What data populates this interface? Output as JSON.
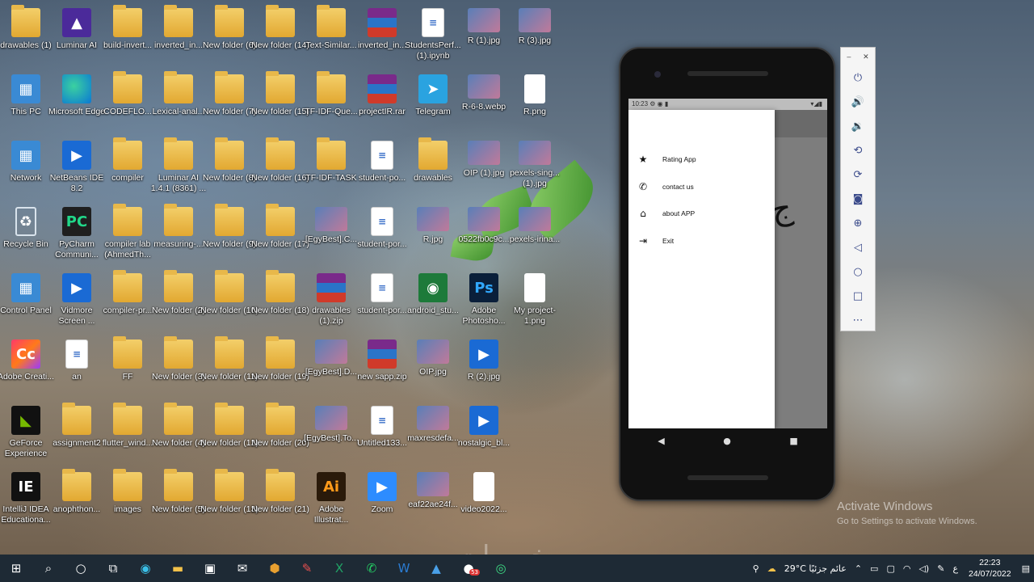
{
  "desktop": {
    "icons": [
      {
        "label": "drawables (1)",
        "icon": "folder-icon",
        "type": "folder"
      },
      {
        "label": "Luminar AI",
        "icon": "luminar-icon",
        "type": "purple"
      },
      {
        "label": "build-invert...",
        "icon": "folder-icon",
        "type": "folder"
      },
      {
        "label": "inverted_in...",
        "icon": "folder-icon",
        "type": "folder"
      },
      {
        "label": "New folder (6)",
        "icon": "folder-icon",
        "type": "folder"
      },
      {
        "label": "New folder (14)",
        "icon": "folder-icon",
        "type": "folder"
      },
      {
        "label": "Text-Similar...",
        "icon": "folder-icon",
        "type": "folder"
      },
      {
        "label": "inverted_in...",
        "icon": "winrar-icon",
        "type": "rar"
      },
      {
        "label": "StudentsPerf... (1).ipynb",
        "icon": "notebook-icon",
        "type": "doc"
      },
      {
        "label": "R (1).jpg",
        "icon": "image-icon",
        "type": "img"
      },
      {
        "label": "R (3).jpg",
        "icon": "image-icon",
        "type": "img"
      },
      {
        "label": "This PC",
        "icon": "computer-icon",
        "type": "cp"
      },
      {
        "label": "Microsoft Edge",
        "icon": "edge-icon",
        "type": "edge"
      },
      {
        "label": "CODEFLO...",
        "icon": "folder-icon",
        "type": "folder"
      },
      {
        "label": "Lexical-anal...",
        "icon": "folder-icon",
        "type": "folder"
      },
      {
        "label": "New folder (7)",
        "icon": "folder-icon",
        "type": "folder"
      },
      {
        "label": "New folder (15)",
        "icon": "folder-icon",
        "type": "folder"
      },
      {
        "label": "TF-IDF-Que...",
        "icon": "folder-icon",
        "type": "folder"
      },
      {
        "label": "projectIR.rar",
        "icon": "winrar-icon",
        "type": "rar"
      },
      {
        "label": "Telegram",
        "icon": "telegram-icon",
        "type": "tele"
      },
      {
        "label": "R-6-8.webp",
        "icon": "image-icon",
        "type": "img"
      },
      {
        "label": "R.png",
        "icon": "speaker-icon",
        "type": "plain"
      },
      {
        "label": "Network",
        "icon": "network-icon",
        "type": "cp"
      },
      {
        "label": "NetBeans IDE 8.2",
        "icon": "netbeans-icon",
        "type": "blue"
      },
      {
        "label": "compiler",
        "icon": "folder-icon",
        "type": "folder"
      },
      {
        "label": "Luminar AI 1.4.1 (8361) ...",
        "icon": "folder-icon",
        "type": "folder"
      },
      {
        "label": "New folder (8)",
        "icon": "folder-icon",
        "type": "folder"
      },
      {
        "label": "New folder (16)",
        "icon": "folder-icon",
        "type": "folder"
      },
      {
        "label": "TF-IDF-TASK",
        "icon": "folder-icon",
        "type": "folder"
      },
      {
        "label": "student-po...",
        "icon": "document-icon",
        "type": "doc"
      },
      {
        "label": "drawables",
        "icon": "folder-icon",
        "type": "folder"
      },
      {
        "label": "OIP (1).jpg",
        "icon": "image-icon",
        "type": "img"
      },
      {
        "label": "pexels-sing... (1).jpg",
        "icon": "image-icon",
        "type": "img"
      },
      {
        "label": "Recycle Bin",
        "icon": "recycle-bin-icon",
        "type": "bin"
      },
      {
        "label": "PyCharm Communi...",
        "icon": "pycharm-icon",
        "type": "pc"
      },
      {
        "label": "compiler lab (AhmedTh...",
        "icon": "folder-icon",
        "type": "folder"
      },
      {
        "label": "measuring-...",
        "icon": "folder-icon",
        "type": "folder"
      },
      {
        "label": "New folder (9)",
        "icon": "folder-icon",
        "type": "folder"
      },
      {
        "label": "New folder (17)",
        "icon": "folder-icon",
        "type": "folder"
      },
      {
        "label": "[EgyBest].C...",
        "icon": "video-icon",
        "type": "img"
      },
      {
        "label": "student-por...",
        "icon": "document-icon",
        "type": "doc"
      },
      {
        "label": "R.jpg",
        "icon": "image-icon",
        "type": "img"
      },
      {
        "label": "0522fb0c9c...",
        "icon": "image-icon",
        "type": "img"
      },
      {
        "label": "pexels-irina...",
        "icon": "image-icon",
        "type": "img"
      },
      {
        "label": "Control Panel",
        "icon": "control-panel-icon",
        "type": "cp"
      },
      {
        "label": "Vidmore Screen ...",
        "icon": "video-camera-icon",
        "type": "blue"
      },
      {
        "label": "compiler-pr...",
        "icon": "folder-icon",
        "type": "folder"
      },
      {
        "label": "New folder (2)",
        "icon": "folder-icon",
        "type": "folder"
      },
      {
        "label": "New folder (10)",
        "icon": "folder-icon",
        "type": "folder"
      },
      {
        "label": "New folder (18)",
        "icon": "folder-icon",
        "type": "folder"
      },
      {
        "label": "drawables (1).zip",
        "icon": "winrar-icon",
        "type": "rar"
      },
      {
        "label": "student-por...",
        "icon": "document-icon",
        "type": "doc"
      },
      {
        "label": "android_stu...",
        "icon": "android-studio-icon",
        "type": "green"
      },
      {
        "label": "Adobe Photosho...",
        "icon": "photoshop-icon",
        "type": "ps"
      },
      {
        "label": "My project-1.png",
        "icon": "image-icon",
        "type": "plain"
      },
      {
        "label": "Adobe Creati...",
        "icon": "adobe-cc-icon",
        "type": "adobe"
      },
      {
        "label": "an",
        "icon": "excel-file-icon",
        "type": "doc"
      },
      {
        "label": "FF",
        "icon": "folder-icon",
        "type": "folder"
      },
      {
        "label": "New folder (3)",
        "icon": "folder-icon",
        "type": "folder"
      },
      {
        "label": "New folder (11)",
        "icon": "folder-icon",
        "type": "folder"
      },
      {
        "label": "New folder (19)",
        "icon": "folder-icon",
        "type": "folder"
      },
      {
        "label": "[EgyBest].D...",
        "icon": "video-icon",
        "type": "img"
      },
      {
        "label": "new sapp.zip",
        "icon": "winrar-icon",
        "type": "rar"
      },
      {
        "label": "OIP.jpg",
        "icon": "image-icon",
        "type": "img"
      },
      {
        "label": "R (2).jpg",
        "icon": "image-icon",
        "type": "blue"
      },
      {
        "label": "GeForce Experience",
        "icon": "nvidia-icon",
        "type": "nvidia"
      },
      {
        "label": "assignment2",
        "icon": "folder-icon",
        "type": "folder"
      },
      {
        "label": "flutter_wind...",
        "icon": "folder-icon",
        "type": "folder"
      },
      {
        "label": "New folder (4)",
        "icon": "folder-icon",
        "type": "folder"
      },
      {
        "label": "New folder (12)",
        "icon": "folder-icon",
        "type": "folder"
      },
      {
        "label": "New folder (20)",
        "icon": "folder-icon",
        "type": "folder"
      },
      {
        "label": "[EgyBest].To...",
        "icon": "video-icon",
        "type": "img"
      },
      {
        "label": "Untitled133...",
        "icon": "document-icon",
        "type": "doc"
      },
      {
        "label": "maxresdefa...",
        "icon": "image-icon",
        "type": "img"
      },
      {
        "label": "nostalgic_bl...",
        "icon": "image-icon",
        "type": "blue"
      },
      {
        "label": "IntelliJ IDEA Educationa...",
        "icon": "intellij-icon",
        "type": "ie"
      },
      {
        "label": "anophthon...",
        "icon": "folder-icon",
        "type": "folder"
      },
      {
        "label": "images",
        "icon": "folder-icon",
        "type": "folder"
      },
      {
        "label": "New folder (5)",
        "icon": "folder-icon",
        "type": "folder"
      },
      {
        "label": "New folder (13)",
        "icon": "folder-icon",
        "type": "folder"
      },
      {
        "label": "New folder (21)",
        "icon": "folder-icon",
        "type": "folder"
      },
      {
        "label": "Adobe Illustrat...",
        "icon": "illustrator-icon",
        "type": "ai"
      },
      {
        "label": "Zoom",
        "icon": "zoom-icon",
        "type": "zoom"
      },
      {
        "label": "eaf22ae24f...",
        "icon": "image-icon",
        "type": "img"
      },
      {
        "label": "video2022...",
        "icon": "file-icon",
        "type": "plain"
      }
    ]
  },
  "phone": {
    "status_time": "10:23",
    "drawer_items": [
      {
        "label": "Rating App",
        "icon": "star-icon"
      },
      {
        "label": "contact us",
        "icon": "phone-icon"
      },
      {
        "label": "about APP",
        "icon": "home-icon"
      },
      {
        "label": "Exit",
        "icon": "exit-icon"
      }
    ]
  },
  "emulator_toolbar": {
    "buttons": [
      "power-icon",
      "volume-up-icon",
      "volume-down-icon",
      "rotate-left-icon",
      "rotate-right-icon",
      "camera-icon",
      "zoom-icon",
      "back-icon",
      "home-icon",
      "overview-icon",
      "more-icon"
    ]
  },
  "activation": {
    "title": "Activate Windows",
    "subtitle": "Go to Settings to activate Windows."
  },
  "watermark": "خمسات",
  "taskbar": {
    "weather": "29°C  عائم جزئيًا",
    "lang": "ع",
    "time": "22:23",
    "date": "24/07/2022",
    "badge": "53"
  }
}
